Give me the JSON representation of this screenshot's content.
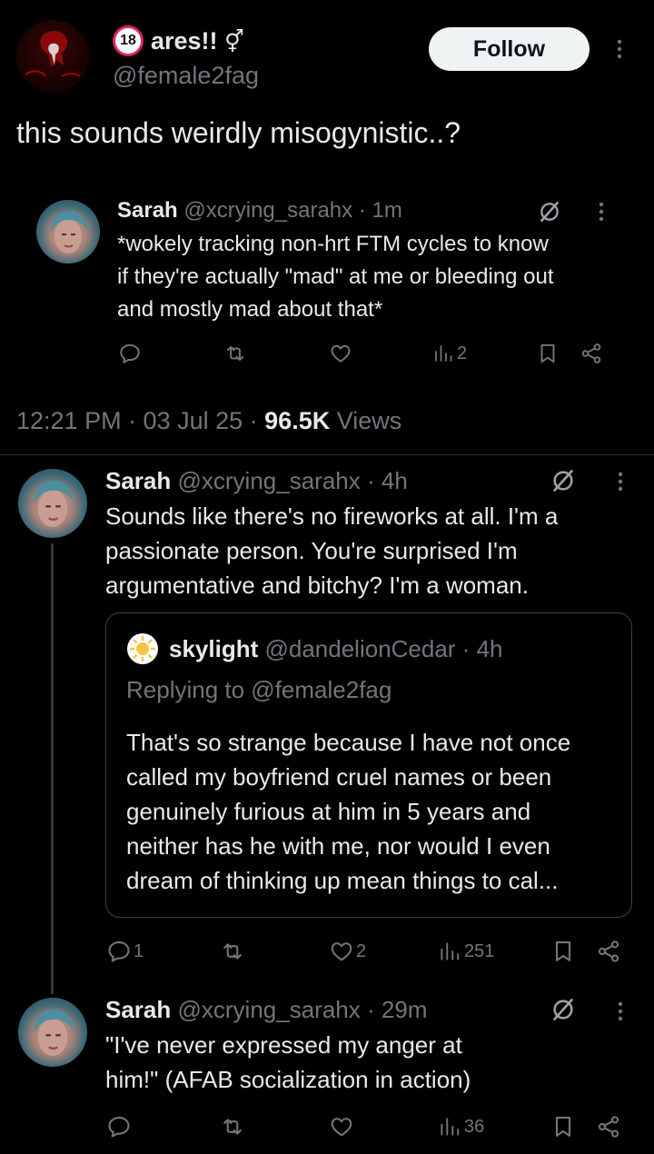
{
  "colors": {
    "background": "#000000",
    "text": "#e7e9ea",
    "secondary": "#71767b",
    "follow_bg": "#eff3f4"
  },
  "main_tweet": {
    "age_badge": "18",
    "display_name": "ares!!",
    "name_symbol": "⚥",
    "handle": "@female2fag",
    "follow_label": "Follow",
    "text": "this sounds weirdly misogynistic..?",
    "quoted": {
      "name": "Sarah",
      "handle": "@xcrying_sarahx",
      "time": "· 1m",
      "text_lines": [
        "*wokely tracking non-hrt FTM cycles to know",
        "if they're actually \"mad\" at me or bleeding out",
        "and mostly mad about that*"
      ],
      "views": "2"
    },
    "timestamp": "12:21 PM · 03 Jul 25 ·",
    "views_count": "96.5K",
    "views_label": "Views"
  },
  "replies": [
    {
      "name": "Sarah",
      "handle": "@xcrying_sarahx",
      "time": "· 4h",
      "text_lines": [
        "Sounds like there's no fireworks at all. I'm a",
        "passionate person. You're surprised I'm",
        "argumentative and bitchy? I'm a woman."
      ],
      "quote": {
        "name": "skylight",
        "handle": "@dandelionCedar",
        "time": "· 4h",
        "replying_to": "Replying to @female2fag",
        "text_lines": [
          "That's so strange because I have not once",
          "called my boyfriend cruel names or been",
          "genuinely furious at him in 5 years and",
          "neither has he with me, nor would I even",
          "dream of thinking up mean things to cal..."
        ]
      },
      "replies_count": "1",
      "likes": "2",
      "views": "251"
    },
    {
      "name": "Sarah",
      "handle": "@xcrying_sarahx",
      "time": "· 29m",
      "text_lines": [
        "\"I've never expressed my anger at",
        "him!\" (AFAB socialization in action)"
      ],
      "views": "36"
    }
  ]
}
